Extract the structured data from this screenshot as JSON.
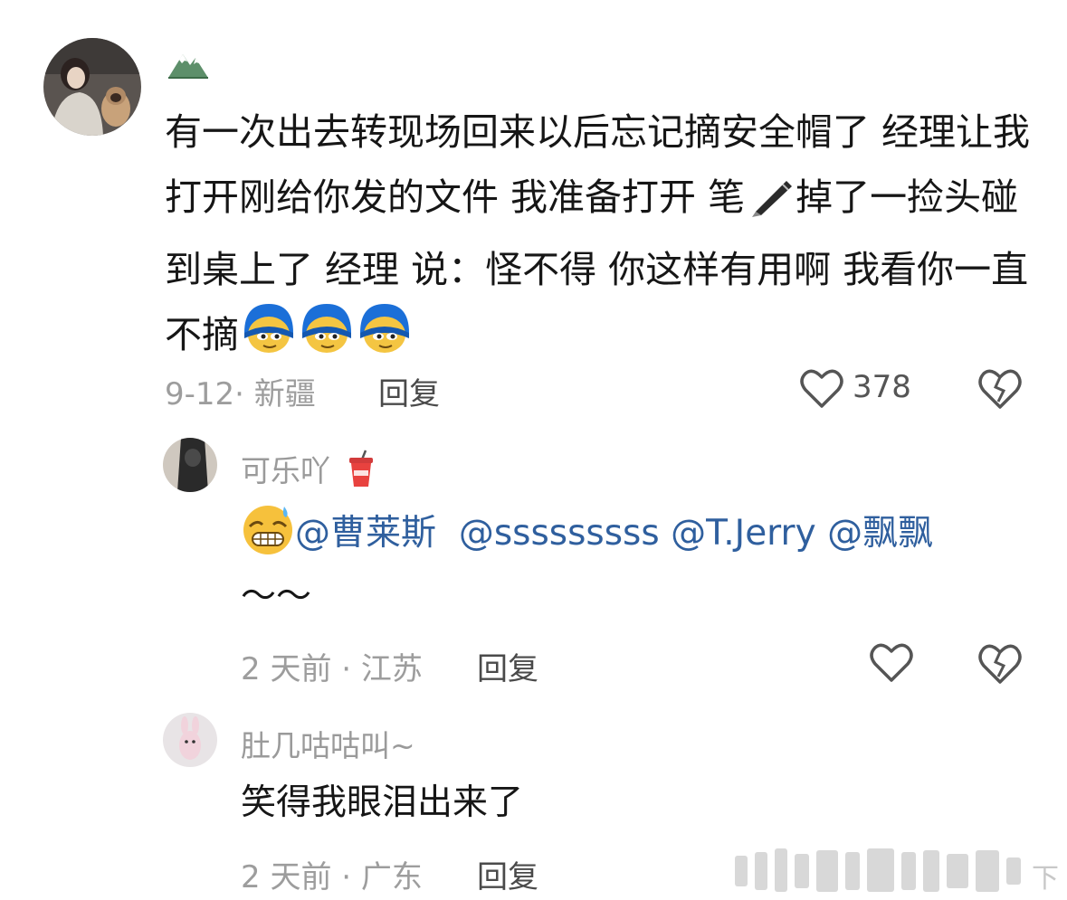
{
  "comment": {
    "author_icon": "mountain-emoji",
    "text_parts": [
      "有一次出去转现场回来以后忘记摘安全帽了 经理让我打开刚给你发的文件 我准备打开 笔",
      "掉了一捡头碰到桌上了   经理 说：怪不得 你这样有用啊 我看你一直不摘"
    ],
    "meta": "9-12· 新疆",
    "reply_label": "回复",
    "like_count": "378"
  },
  "replies": [
    {
      "name": "可乐吖",
      "name_icon": "cup-emoji",
      "mentions": [
        "@曹莱斯",
        "@sssssssss",
        "@T.Jerry",
        "@飘飘"
      ],
      "tail": "～～",
      "meta": "2 天前 · 江苏",
      "reply_label": "回复"
    },
    {
      "name": "肚几咕咕叫~",
      "text": "笑得我眼泪出来了",
      "meta": "2 天前 · 广东",
      "reply_label": "回复"
    }
  ],
  "watermark": "下",
  "colors": {
    "mention": "#2f5f9e",
    "meta": "#9d9d9d",
    "text": "#161616"
  }
}
